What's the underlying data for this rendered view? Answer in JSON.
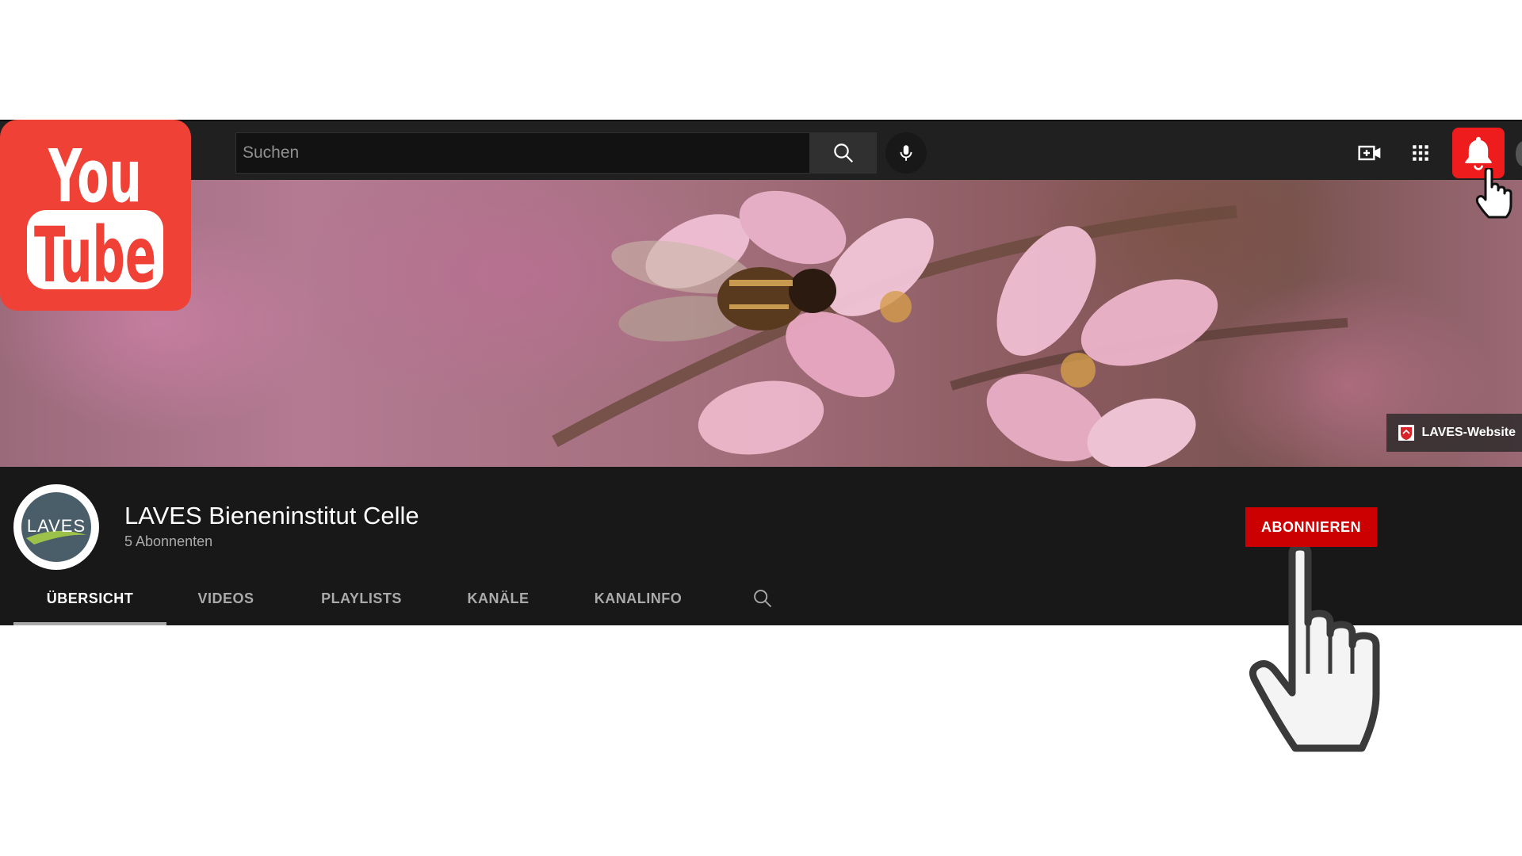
{
  "logo": {
    "line1": "You",
    "line2": "Tube"
  },
  "search": {
    "placeholder": "Suchen"
  },
  "icons": {
    "search": "search-icon",
    "mic": "microphone-icon",
    "create": "video-add-icon",
    "apps": "apps-grid-icon",
    "notifications": "bell-icon"
  },
  "banner": {
    "link_label": "LAVES-Website"
  },
  "channel": {
    "avatar_text": "LAVES",
    "name": "LAVES Bieneninstitut Celle",
    "subscribers": "5 Abonnenten",
    "subscribe_label": "ABONNIEREN"
  },
  "tabs": [
    {
      "label": "ÜBERSICHT",
      "active": true
    },
    {
      "label": "VIDEOS",
      "active": false
    },
    {
      "label": "PLAYLISTS",
      "active": false
    },
    {
      "label": "KANÄLE",
      "active": false
    },
    {
      "label": "KANALINFO",
      "active": false
    }
  ],
  "colors": {
    "accent_red": "#cc0000",
    "bell_red": "#ee1c1c",
    "logo_red": "#ef4136",
    "dark_bg": "#181818"
  }
}
